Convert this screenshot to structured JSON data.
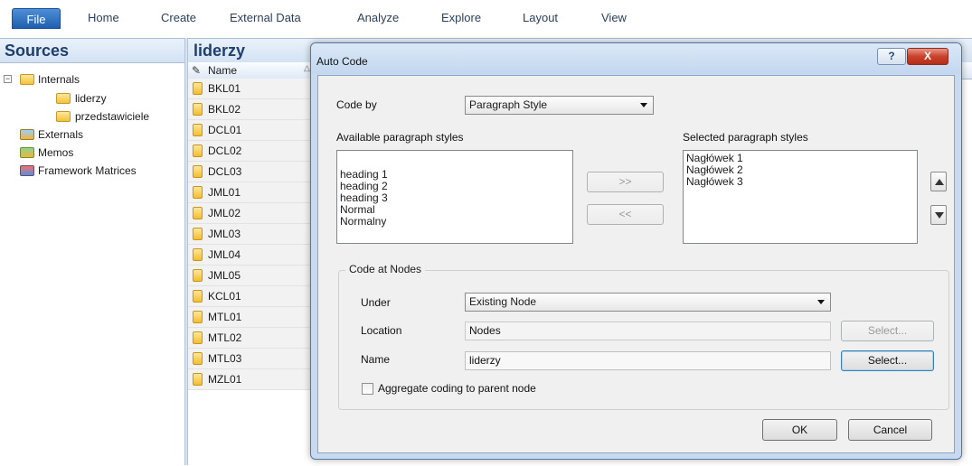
{
  "ribbon": {
    "tabs": [
      "File",
      "Home",
      "Create",
      "External Data",
      "Analyze",
      "Explore",
      "Layout",
      "View"
    ]
  },
  "sources": {
    "title": "Sources",
    "tree": {
      "internals": "Internals",
      "internals_children": [
        "liderzy",
        "przedstawiciele"
      ],
      "externals": "Externals",
      "memos": "Memos",
      "framework": "Framework Matrices"
    }
  },
  "list": {
    "title": "liderzy",
    "column_name": "Name",
    "rows": [
      "BKL01",
      "BKL02",
      "DCL01",
      "DCL02",
      "DCL03",
      "JML01",
      "JML02",
      "JML03",
      "JML04",
      "JML05",
      "KCL01",
      "MTL01",
      "MTL02",
      "MTL03",
      "MZL01"
    ]
  },
  "dialog": {
    "title": "Auto Code",
    "help": "?",
    "close": "X",
    "code_by_label": "Code by",
    "code_by_value": "Paragraph Style",
    "available_label": "Available paragraph styles",
    "available_items": [
      "heading 1",
      "heading 2",
      "heading 3",
      "Normal",
      "Normalny"
    ],
    "selected_label": "Selected paragraph styles",
    "selected_items": [
      "Nagłówek 1",
      "Nagłówek 2",
      "Nagłówek 3"
    ],
    "add_btn": ">>",
    "remove_btn": "<<",
    "group_title": "Code at Nodes",
    "under_label": "Under",
    "under_value": "Existing Node",
    "location_label": "Location",
    "location_value": "Nodes",
    "location_select": "Select...",
    "name_label": "Name",
    "name_value": "liderzy",
    "name_select": "Select...",
    "aggregate_label": "Aggregate coding to parent node",
    "ok": "OK",
    "cancel": "Cancel"
  }
}
